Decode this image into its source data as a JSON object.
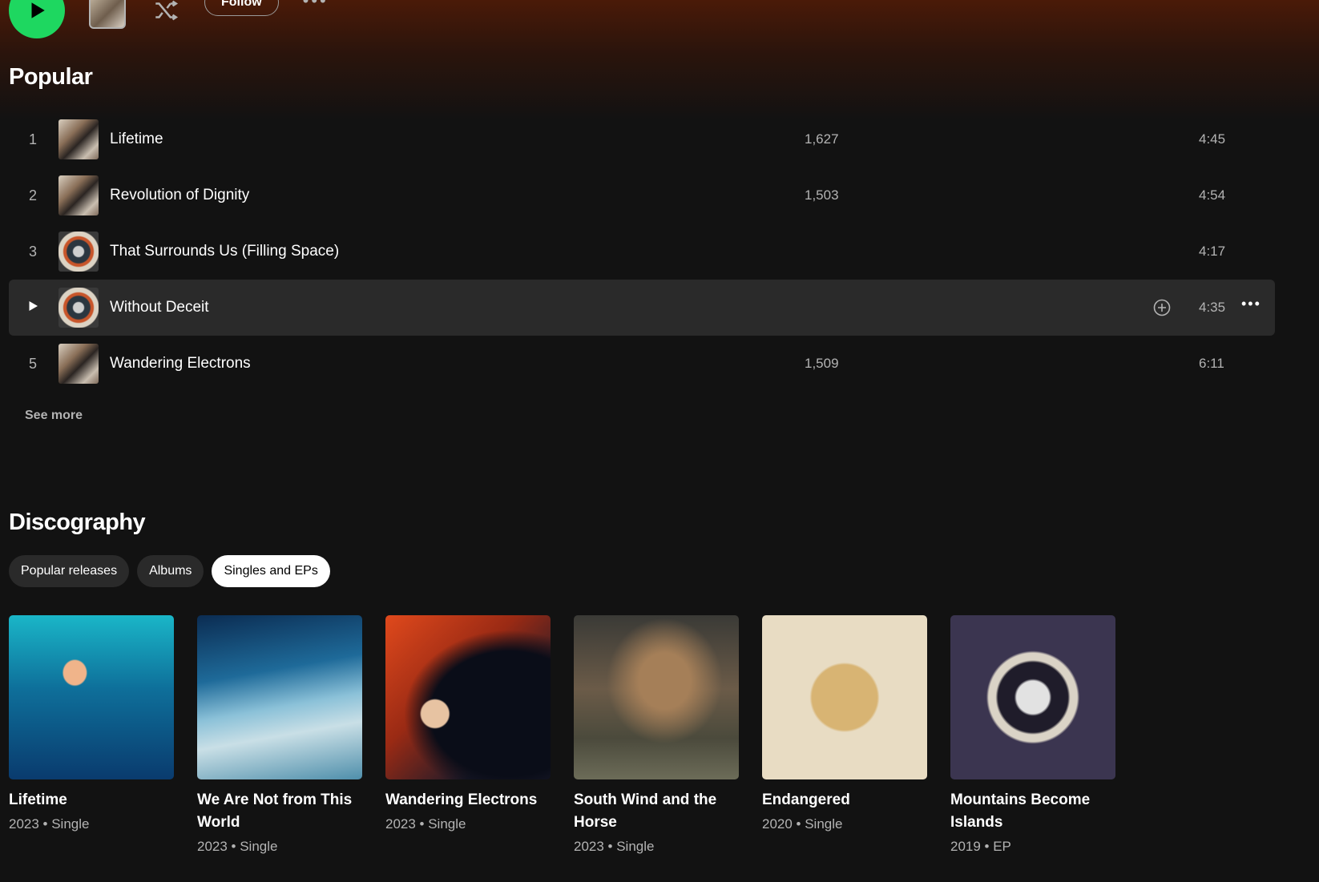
{
  "action_bar": {
    "follow_label": "Follow",
    "more_label": "•••"
  },
  "popular": {
    "title": "Popular",
    "tracks": [
      {
        "num": "1",
        "title": "Lifetime",
        "plays": "1,627",
        "duration": "4:45",
        "cover": "cover-a"
      },
      {
        "num": "2",
        "title": "Revolution of Dignity",
        "plays": "1,503",
        "duration": "4:54",
        "cover": "cover-a"
      },
      {
        "num": "3",
        "title": "That Surrounds Us (Filling Space)",
        "plays": "",
        "duration": "4:17",
        "cover": "cover-b"
      },
      {
        "num": "4",
        "title": "Without Deceit",
        "plays": "",
        "duration": "4:35",
        "cover": "cover-b"
      },
      {
        "num": "5",
        "title": "Wandering Electrons",
        "plays": "1,509",
        "duration": "6:11",
        "cover": "cover-a"
      }
    ],
    "see_more": "See more"
  },
  "discography": {
    "title": "Discography",
    "filters": [
      "Popular releases",
      "Albums",
      "Singles and EPs"
    ],
    "active_filter": "Singles and EPs",
    "releases": [
      {
        "title": "Lifetime",
        "meta": "2023 • Single"
      },
      {
        "title": "We Are Not from This World",
        "meta": "2023 • Single"
      },
      {
        "title": "Wandering Electrons",
        "meta": "2023 • Single"
      },
      {
        "title": "South Wind and the Horse",
        "meta": "2023 • Single"
      },
      {
        "title": "Endangered",
        "meta": "2020 • Single"
      },
      {
        "title": "Mountains Become Islands",
        "meta": "2019 • EP"
      }
    ]
  },
  "colors": {
    "accent": "#1ed760",
    "background": "#121212",
    "hover_row": "#2a2a2a"
  }
}
